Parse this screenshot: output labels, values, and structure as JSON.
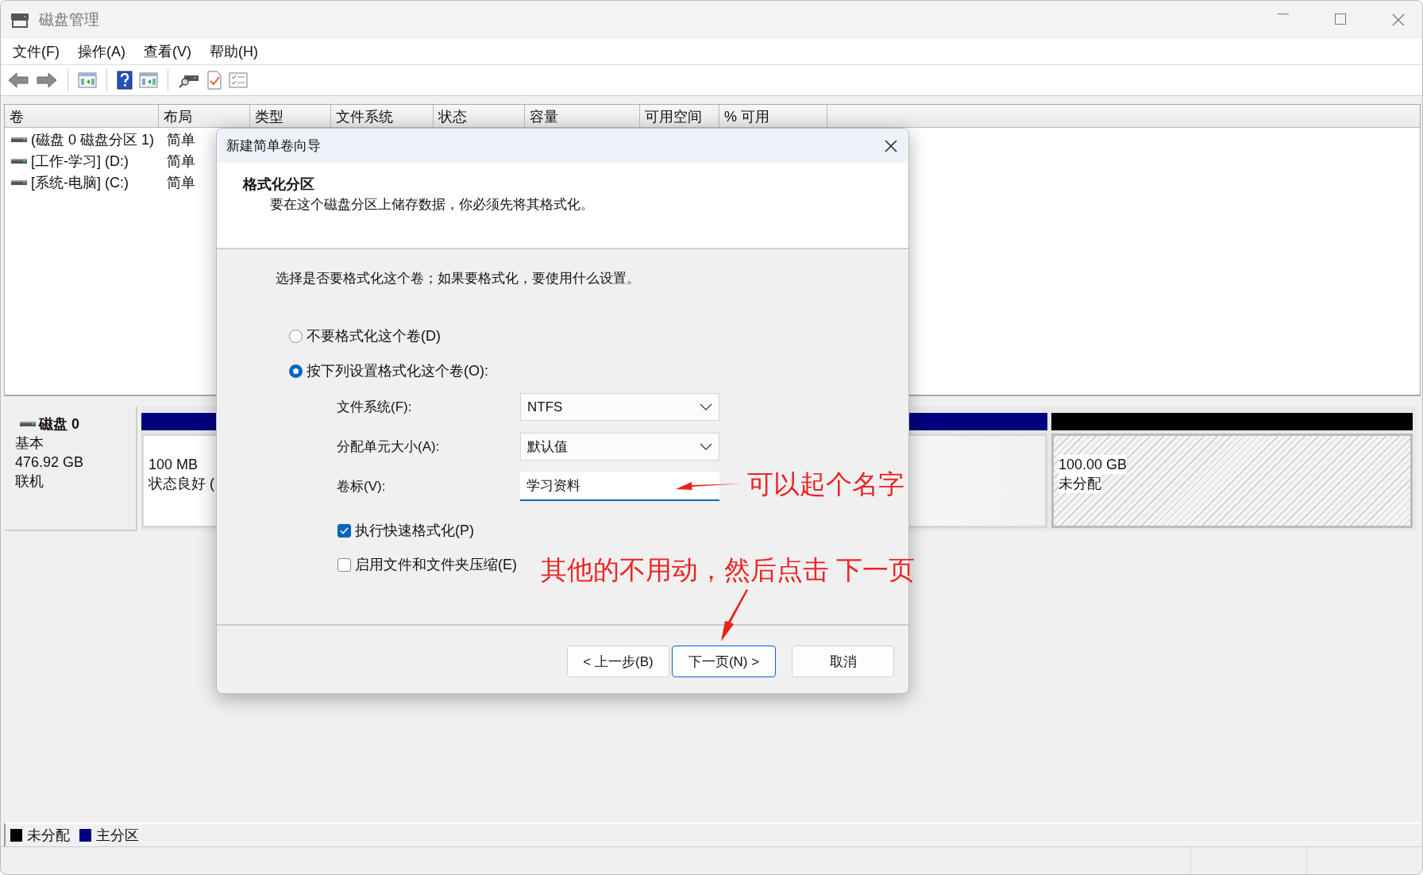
{
  "window": {
    "title": "磁盘管理"
  },
  "menu": [
    {
      "label": "文件(F)"
    },
    {
      "label": "操作(A)"
    },
    {
      "label": "查看(V)"
    },
    {
      "label": "帮助(H)"
    }
  ],
  "volume_table": {
    "columns": [
      "卷",
      "布局",
      "类型",
      "文件系统",
      "状态",
      "容量",
      "可用空间",
      "% 可用"
    ],
    "rows": [
      {
        "cells": [
          "(磁盘 0 磁盘分区 1)",
          "简单"
        ]
      },
      {
        "cells": [
          "[工作-学习] (D:)",
          "简单"
        ]
      },
      {
        "cells": [
          "[系统-电脑] (C:)",
          "简单"
        ]
      }
    ]
  },
  "disk": {
    "name": "磁盘 0",
    "type": "基本",
    "size": "476.92 GB",
    "status": "联机",
    "partitions": [
      {
        "kind": "primary",
        "color": "#000080",
        "size": "100 MB",
        "status": "状态良好 ("
      },
      {
        "kind": "primary",
        "color": "#000080"
      },
      {
        "kind": "unallocated",
        "color": "#000000",
        "size": "100.00 GB",
        "status": "未分配"
      }
    ]
  },
  "legend": [
    {
      "label": "未分配",
      "color": "#000000"
    },
    {
      "label": "主分区",
      "color": "#000080"
    }
  ],
  "dialog": {
    "title": "新建简单卷向导",
    "heading": "格式化分区",
    "subtitle": "要在这个磁盘分区上储存数据，你必须先将其格式化。",
    "instruction": "选择是否要格式化这个卷；如果要格式化，要使用什么设置。",
    "options": [
      {
        "label": "不要格式化这个卷(D)",
        "selected": false
      },
      {
        "label": "按下列设置格式化这个卷(O):",
        "selected": true
      }
    ],
    "fields": [
      {
        "kind": "dropdown",
        "label": "文件系统(F):",
        "value": "NTFS"
      },
      {
        "kind": "dropdown",
        "label": "分配单元大小(A):",
        "value": "默认值"
      },
      {
        "kind": "text",
        "label": "卷标(V):",
        "value": "学习资料"
      }
    ],
    "checkboxes": [
      {
        "label": "执行快速格式化(P)",
        "checked": true
      },
      {
        "label": "启用文件和文件夹压缩(E)",
        "checked": false
      }
    ],
    "buttons": [
      {
        "label": "< 上一步(B)",
        "default": false
      },
      {
        "label": "下一页(N) >",
        "default": true
      },
      {
        "label": "取消",
        "default": false
      }
    ]
  },
  "annotations": [
    {
      "text": "可以起个名字"
    },
    {
      "text": "其他的不用动，然后点击 下一页"
    }
  ]
}
